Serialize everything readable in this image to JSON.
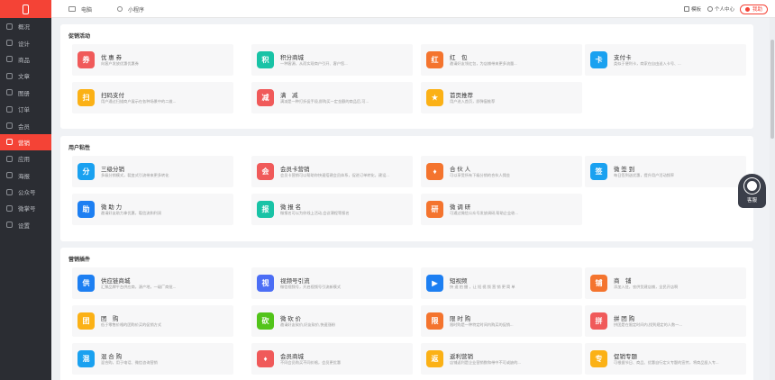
{
  "sidebar": {
    "items": [
      {
        "label": "概况",
        "active": false
      },
      {
        "label": "设计",
        "active": false
      },
      {
        "label": "商品",
        "active": false
      },
      {
        "label": "文章",
        "active": false
      },
      {
        "label": "图册",
        "active": false
      },
      {
        "label": "订单",
        "active": false
      },
      {
        "label": "会员",
        "active": false
      },
      {
        "label": "营销",
        "active": true
      },
      {
        "label": "应用",
        "active": false
      },
      {
        "label": "海报",
        "active": false
      },
      {
        "label": "公众号",
        "active": false
      },
      {
        "label": "微掌号",
        "active": false
      },
      {
        "label": "设置",
        "active": false
      }
    ]
  },
  "topbar": {
    "tabs": [
      {
        "label": "电脑",
        "icon": "monitor-icon"
      },
      {
        "label": "小程序",
        "icon": "mini-program-icon"
      }
    ],
    "template_label": "模板",
    "user_center_label": "个人中心",
    "help_label": "我助"
  },
  "sections": [
    {
      "title": "促销活动",
      "cards": [
        {
          "title": "优 惠 券",
          "desc": "向客户发放优惠优惠券",
          "color": "#f05a5a",
          "glyph": "券",
          "icon": "coupon-icon"
        },
        {
          "title": "积分商城",
          "desc": "一种客源，从而实现商户引开、客户您...",
          "color": "#19c3a6",
          "glyph": "积",
          "icon": "points-mall-icon"
        },
        {
          "title": "红　包",
          "desc": "邀请好友领红包，为店铺带来更多流量...",
          "color": "#f4742e",
          "glyph": "红",
          "icon": "red-packet-icon"
        },
        {
          "title": "支付卡",
          "desc": "类似于便利卡，商家在自由送入卡号、...",
          "color": "#1aa1f0",
          "glyph": "卡",
          "icon": "pay-card-icon"
        },
        {
          "title": "扫码支付",
          "desc": "用户通过扫描商户展示在各种场景中的二维...",
          "color": "#fbb116",
          "glyph": "扫",
          "icon": "scan-pay-icon"
        },
        {
          "title": "满　减",
          "desc": "满减是一种打折促手段,即购买一定金额的商品后,可...",
          "color": "#f05a5a",
          "glyph": "减",
          "icon": "full-reduction-icon"
        },
        {
          "title": "首页推荐",
          "desc": "用户进入首页，即弹窗推荐",
          "color": "#fbb116",
          "glyph": "★",
          "icon": "homepage-recommend-icon"
        }
      ]
    },
    {
      "title": "用户粘性",
      "cards": [
        {
          "title": "三级分销",
          "desc": "多级分销模式，裂变式引流带来更多转化",
          "color": "#1aa1f0",
          "glyph": "分",
          "icon": "distribution-icon"
        },
        {
          "title": "会员卡营销",
          "desc": "会员卡营销可以帮助你快速搭建会员体系，促进订单转化，建设...",
          "color": "#f05a5a",
          "glyph": "会",
          "icon": "member-card-icon"
        },
        {
          "title": "合 伙 人",
          "desc": "可以享受所有下级分销的合伙人佣金",
          "color": "#f4742e",
          "glyph": "♦",
          "icon": "partner-icon"
        },
        {
          "title": "微 签 到",
          "desc": "每日签到送优惠，提升用户活动频率",
          "color": "#1aa1f0",
          "glyph": "签",
          "icon": "sign-in-icon"
        },
        {
          "title": "微 助 力",
          "desc": "邀请好友助力拿优惠，裂信流和利润",
          "color": "#1d7ff2",
          "glyph": "助",
          "icon": "boost-icon"
        },
        {
          "title": "微 报 名",
          "desc": "微报名可以为你线上活动,会议课程等报名",
          "color": "#19c3a6",
          "glyph": "报",
          "icon": "sign-up-icon"
        },
        {
          "title": "微 调 研",
          "desc": "可通过微信公众号发放调研,帮助企业收...",
          "color": "#f4742e",
          "glyph": "研",
          "icon": "survey-icon"
        }
      ]
    },
    {
      "title": "营销插件",
      "cards": [
        {
          "title": "供应链商城",
          "desc": "汇聚品牌平台供应商，源产地，一级厂商批...",
          "color": "#1d7ff2",
          "glyph": "供",
          "icon": "supply-chain-icon"
        },
        {
          "title": "视频号引流",
          "desc": "微信视频号，开启视频号引流新模式",
          "color": "#4c6ef5",
          "glyph": "视",
          "icon": "video-channel-icon"
        },
        {
          "title": "短视频",
          "desc": "快 速 拍 摄 ，让 短 视 频 营 销 更 简 单",
          "color": "#1d7ff2",
          "glyph": "▶",
          "icon": "short-video-icon"
        },
        {
          "title": "商　铺",
          "desc": "添加入驻，农供货建店铺，全民开店啊",
          "color": "#f4742e",
          "glyph": "铺",
          "icon": "shop-icon"
        },
        {
          "title": "团　购",
          "desc": "低于零售价格的团购价买的促销方式",
          "color": "#fbb116",
          "glyph": "团",
          "icon": "group-buy-icon"
        },
        {
          "title": "微 砍 价",
          "desc": "邀请好友砍价,好友砍价,快速涨粉",
          "color": "#52c41a",
          "glyph": "砍",
          "icon": "bargain-icon"
        },
        {
          "title": "限 时 购",
          "desc": "限时购是一种特定时间内购买的促销...",
          "color": "#f4742e",
          "glyph": "限",
          "icon": "flash-sale-icon"
        },
        {
          "title": "拼 团 购",
          "desc": "拼团是在限定时间内,找到规定的人数一...",
          "color": "#f05a5a",
          "glyph": "拼",
          "icon": "group-deal-icon"
        },
        {
          "title": "混 合 购",
          "desc": "混合购，用于电话、微信咨询营销",
          "color": "#1aa1f0",
          "glyph": "混",
          "icon": "mixed-buy-icon"
        },
        {
          "title": "会员商城",
          "desc": "不同会员购买不同价格，会员更优惠",
          "color": "#f05a5a",
          "glyph": "♦",
          "icon": "member-mall-icon"
        },
        {
          "title": "返利营销",
          "desc": "店铺返利是企业营销数和带中不可或缺的...",
          "color": "#fbb116",
          "glyph": "返",
          "icon": "rebate-icon"
        },
        {
          "title": "促销专题",
          "desc": "可根据节日、商品、优惠自行定义专题的宣传，将商品投入专...",
          "color": "#fbb116",
          "glyph": "专",
          "icon": "promo-topic-icon"
        }
      ]
    }
  ],
  "service_widget": {
    "label": "客服",
    "icon": "customer-service-icon"
  }
}
